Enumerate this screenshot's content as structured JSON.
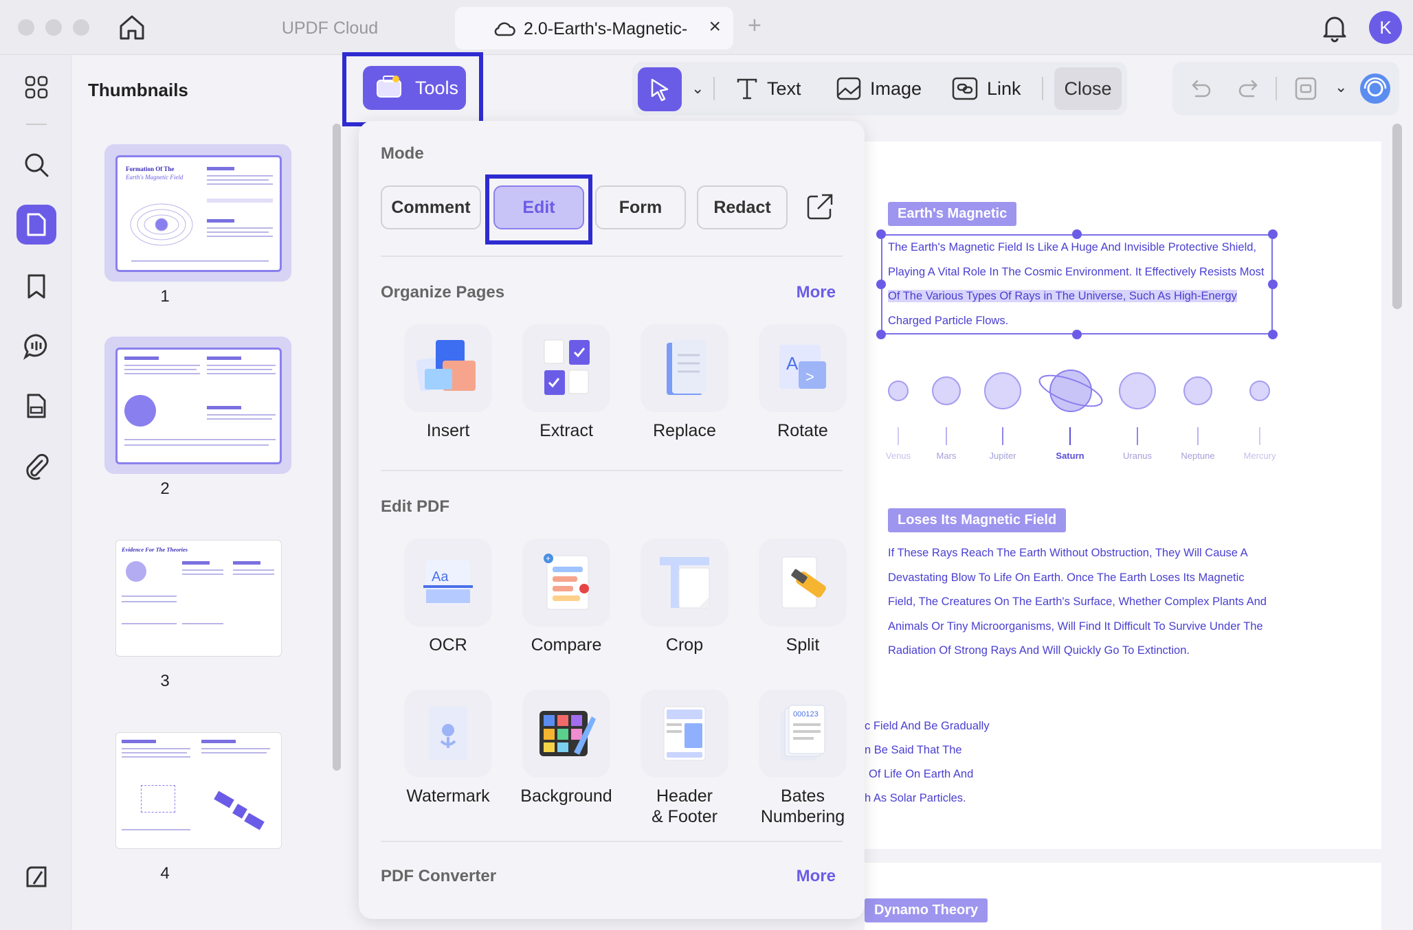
{
  "titlebar": {
    "tabs": [
      {
        "label": "UPDF Cloud"
      },
      {
        "label": "2.0-Earth's-Magnetic-"
      }
    ],
    "avatar_initial": "K"
  },
  "sidebar": {
    "title": "Thumbnails",
    "pages": [
      {
        "number": "1",
        "thumb_title": "Formation Of The",
        "thumb_subtitle": "Earth's Magnetic Field"
      },
      {
        "number": "2"
      },
      {
        "number": "3",
        "thumb_title": "Evidence For The Theories"
      },
      {
        "number": "4"
      }
    ]
  },
  "toolbar": {
    "tools_label": "Tools",
    "text_label": "Text",
    "image_label": "Image",
    "link_label": "Link",
    "close_label": "Close"
  },
  "tools_menu": {
    "mode_title": "Mode",
    "modes": [
      "Comment",
      "Edit",
      "Form",
      "Redact"
    ],
    "active_mode": "Edit",
    "organize": {
      "title": "Organize Pages",
      "more": "More",
      "items": [
        "Insert",
        "Extract",
        "Replace",
        "Rotate"
      ]
    },
    "edit": {
      "title": "Edit PDF",
      "items": [
        "OCR",
        "Compare",
        "Crop",
        "Split"
      ],
      "items2": [
        "Watermark",
        "Background",
        "Header\n& Footer",
        "Bates\nNumbering"
      ],
      "items2_lines": [
        [
          "Watermark"
        ],
        [
          "Background"
        ],
        [
          "Header",
          "& Footer"
        ],
        [
          "Bates",
          "Numbering"
        ]
      ]
    },
    "converter": {
      "title": "PDF Converter",
      "more": "More"
    }
  },
  "document": {
    "heading1": "Earth's Magnetic",
    "para1": [
      "The Earth's Magnetic Field Is Like A Huge And Invisible Protective Shield,",
      "Playing A Vital Role In The Cosmic Environment. It Effectively Resists Most",
      "Of The Various Types Of Rays in The Universe, Such As High-Energy",
      "Charged Particle Flows."
    ],
    "planets": [
      "Venus",
      "Mars",
      "Jupiter",
      "Saturn",
      "Uranus",
      "Neptune",
      "Mercury"
    ],
    "heading2": "Loses Its Magnetic Field",
    "para2": [
      "If These Rays Reach The Earth Without Obstruction, They Will Cause A",
      "Devastating Blow To Life On Earth. Once The Earth Loses Its Magnetic",
      "Field, The Creatures On The Earth's Surface, Whether Complex Plants And",
      "Animals Or Tiny Microorganisms, Will Find It Difficult To Survive Under The",
      "Radiation Of Strong Rays And Will Quickly Go To Extinction."
    ],
    "para3": [
      "c Field And Be Gradually",
      "n Be Said That The",
      "Of Life On Earth And",
      "h As Solar Particles."
    ],
    "heading3": "Dynamo Theory"
  }
}
